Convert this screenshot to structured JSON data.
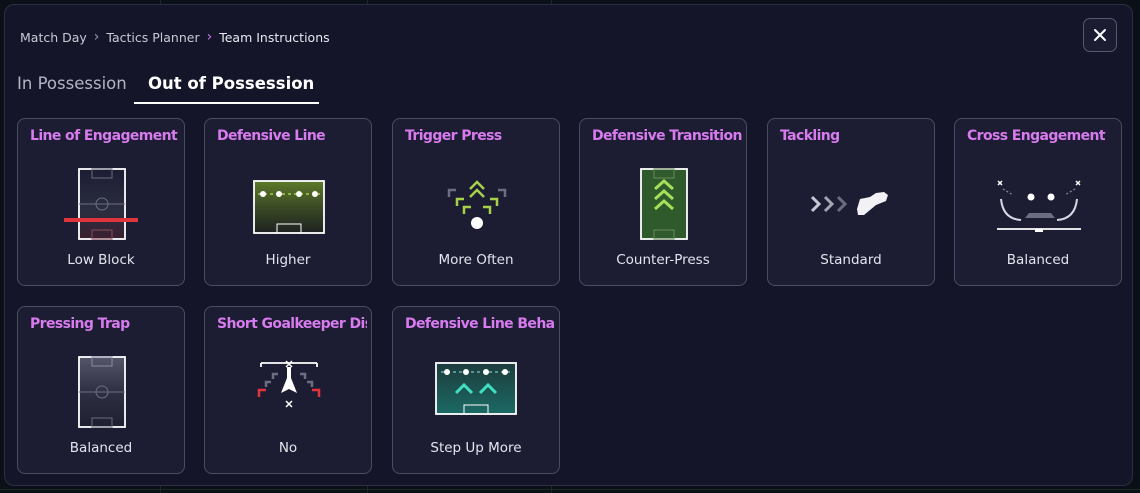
{
  "breadcrumb": {
    "items": [
      "Match Day",
      "Tactics Planner",
      "Team Instructions"
    ]
  },
  "tabs": [
    {
      "label": "In Possession",
      "active": false
    },
    {
      "label": "Out of Possession",
      "active": true
    }
  ],
  "close_icon": "close-icon",
  "accent_color": "#d77bee",
  "cards": [
    {
      "title": "Line of Engagement",
      "value": "Low Block",
      "icon": "low-block-pitch-icon"
    },
    {
      "title": "Defensive Line",
      "value": "Higher",
      "icon": "higher-line-pitch-icon"
    },
    {
      "title": "Trigger Press",
      "value": "More Often",
      "icon": "press-arrows-icon"
    },
    {
      "title": "Defensive Transition",
      "value": "Counter-Press",
      "icon": "counter-press-pitch-icon"
    },
    {
      "title": "Tackling",
      "value": "Standard",
      "icon": "boot-tackle-icon"
    },
    {
      "title": "Cross Engagement",
      "value": "Balanced",
      "icon": "cross-engagement-icon"
    },
    {
      "title": "Pressing Trap",
      "value": "Balanced",
      "icon": "pressing-trap-pitch-icon"
    },
    {
      "title": "Short Goalkeeper Distr",
      "value": "No",
      "icon": "goalkeeper-distribution-icon"
    },
    {
      "title": "Defensive Line Behavio",
      "value": "Step Up More",
      "icon": "step-up-pitch-icon"
    }
  ]
}
